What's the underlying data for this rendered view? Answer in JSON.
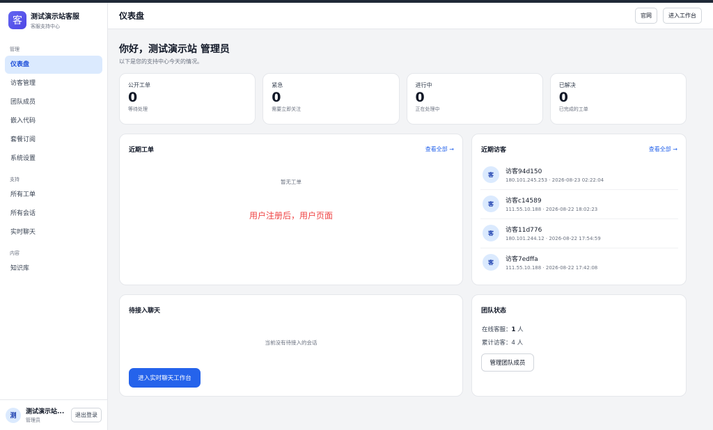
{
  "brand": {
    "logo_char": "客",
    "title": "测试演示站客服",
    "subtitle": "客服支持中心"
  },
  "nav": {
    "sections": [
      {
        "label": "管理",
        "items": [
          "仪表盘",
          "访客管理",
          "团队成员",
          "嵌入代码",
          "套餐订阅",
          "系统设置"
        ]
      },
      {
        "label": "支持",
        "items": [
          "所有工单",
          "所有会话",
          "实时聊天"
        ]
      },
      {
        "label": "内容",
        "items": [
          "知识库"
        ]
      }
    ],
    "active": "仪表盘"
  },
  "user": {
    "avatar_char": "测",
    "name": "测试演示站...",
    "role": "管理员",
    "logout_label": "退出登录"
  },
  "header": {
    "title": "仪表盘",
    "btn_site": "官网",
    "btn_workbench": "进入工作台"
  },
  "greeting": {
    "title": "你好，测试演示站 管理员",
    "subtitle": "以下是您的支持中心今天的情况。"
  },
  "stats": [
    {
      "label": "公开工单",
      "value": "0",
      "desc": "等待处理"
    },
    {
      "label": "紧急",
      "value": "0",
      "desc": "需要立即关注"
    },
    {
      "label": "进行中",
      "value": "0",
      "desc": "正在处理中"
    },
    {
      "label": "已解决",
      "value": "0",
      "desc": "已完成的工单"
    }
  ],
  "recent_tickets": {
    "title": "近期工单",
    "link": "查看全部 →",
    "empty": "暂无工单",
    "note": "用户注册后，用户页面"
  },
  "recent_visitors": {
    "title": "近期访客",
    "link": "查看全部 →",
    "avatar_char": "客",
    "items": [
      {
        "name": "访客94d150",
        "meta": "180.101.245.253 · 2026-08-23 02:22:04"
      },
      {
        "name": "访客c14589",
        "meta": "111.55.10.188 · 2026-08-22 18:02:23"
      },
      {
        "name": "访客11d776",
        "meta": "180.101.244.12 · 2026-08-22 17:54:59"
      },
      {
        "name": "访客7edffa",
        "meta": "111.55.10.188 · 2026-08-22 17:42:08"
      }
    ]
  },
  "pending_chat": {
    "title": "待接入聊天",
    "empty": "当前没有待接入的会话",
    "button": "进入实时聊天工作台"
  },
  "team_status": {
    "title": "团队状态",
    "online_label": "在线客服：",
    "online_value": "1",
    "online_unit": " 人",
    "total_line": "累计访客：4 人",
    "button": "管理团队成员"
  }
}
